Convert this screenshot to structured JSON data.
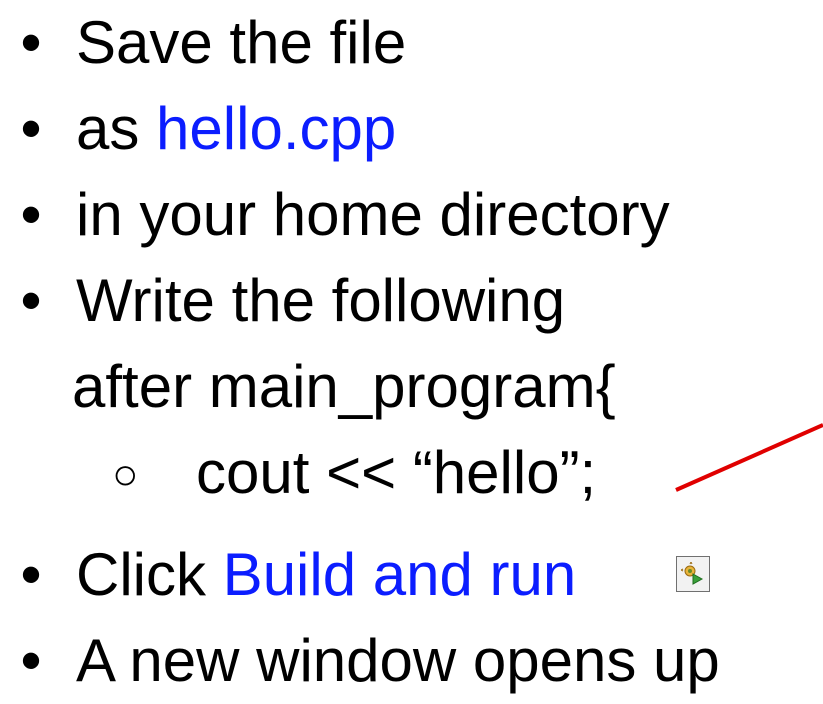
{
  "bullets": {
    "b1": {
      "text": "Save the file"
    },
    "b2": {
      "prefix": "as ",
      "link": "hello.cpp"
    },
    "b3": {
      "text": "in your home directory"
    },
    "b4": {
      "text": "Write the following",
      "cont": "after main_program{"
    },
    "sub1": {
      "text": "cout << “hello”;"
    },
    "b5": {
      "prefix": "Click ",
      "link": "Build and run"
    },
    "b6": {
      "text": "A new window opens up"
    }
  },
  "symbols": {
    "bullet": "•",
    "sub_bullet": "○"
  },
  "icons": {
    "build_and_run": "build-and-run-icon"
  },
  "colors": {
    "accent": "#0b1dff",
    "annotation": "#e00000"
  }
}
